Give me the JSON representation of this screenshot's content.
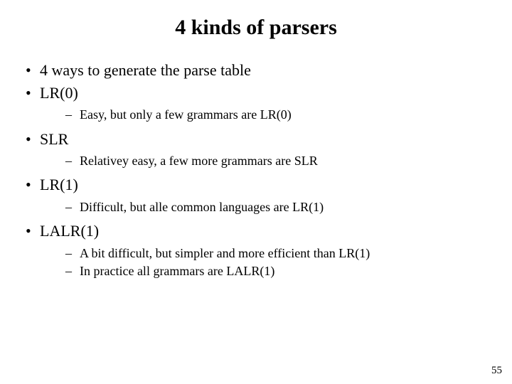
{
  "title": "4 kinds of parsers",
  "b0": "4 ways to generate the parse table",
  "b1": "LR(0)",
  "b1s0": "Easy, but only a few grammars are LR(0)",
  "b2": "SLR",
  "b2s0": "Relativey easy, a few more grammars are SLR",
  "b3": "LR(1)",
  "b3s0": "Difficult, but alle common languages are LR(1)",
  "b4": "LALR(1)",
  "b4s0": "A bit difficult, but simpler and more efficient than LR(1)",
  "b4s1": "In practice all grammars are LALR(1)",
  "page": "55"
}
